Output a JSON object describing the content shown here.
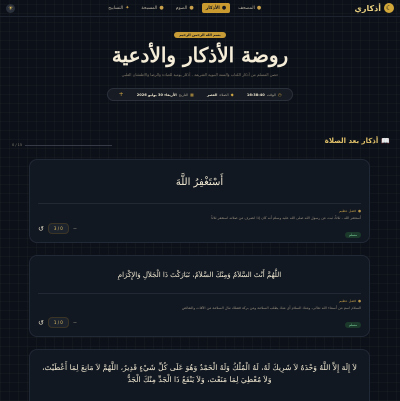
{
  "nav": {
    "brand": "أذكاري",
    "items": [
      {
        "label": "المصحف",
        "active": false
      },
      {
        "label": "الأذكار",
        "active": true
      },
      {
        "label": "الصوم",
        "active": false
      },
      {
        "label": "المسبحة",
        "active": false
      },
      {
        "label": "التسابيح",
        "active": false
      }
    ]
  },
  "hero": {
    "badge": "بسم الله الرحمن الرحيم",
    "title": "روضة الأذكار والأدعية",
    "subtitle": "حصن المسلم من أذكار الكتاب والسنة النبوية الشريفة - أذكار يومية للعبادة والرضا والاطمئنان القلبي"
  },
  "info": {
    "time_label": "الوقت",
    "time": "16:38:40",
    "prayer_label": "الصلاة",
    "prayer": "العصر",
    "date_label": "التاريخ",
    "date": "الأربعاء 30 يوليو 2026"
  },
  "progress": {
    "count": "0 / 15",
    "value": 0
  },
  "section": {
    "title": "أذكار بعد الصلاة"
  },
  "cards": [
    {
      "dhikr": "أَسْتَغْفِرُ اللَّهَ",
      "note_tag": "فضل عظيم",
      "note_text": "أستغفر الله - ثلاثاً، ثبت عن رسول الله صلى الله عليه وسلم أنه كان إذا انصرف من صلاته استغفر ثلاثاً",
      "source": "مسلم",
      "count": "3 / 0"
    },
    {
      "dhikr": "اللَّهُمَّ أَنْتَ السَّلاَمُ وَمِنْكَ السَّلاَمُ، تَبَارَكْتَ ذَا الْجَلاَلِ وَالإِكْرَامِ",
      "note_tag": "فضل عظيم",
      "note_text": "السلام اسم من أسماء الله تعالى، ومنك السلام أي منك يطلب السلامة ومن بركة فضلك ننال السلامة من الآفات والنقائص",
      "source": "مسلم",
      "count": "1 / 0"
    },
    {
      "dhikr": "لاَ إِلَهَ إِلاَّ اللَّهُ وَحْدَهُ لاَ شَرِيكَ لَهُ، لَهُ الْمُلْكُ وَلَهُ الْحَمْدُ وَهُوَ عَلَى كُلِّ شَيْءٍ قَدِيرٌ، اللَّهُمَّ لاَ مَانِعَ لِمَا أَعْطَيْتَ، وَلاَ مُعْطِيَ لِمَا مَنَعْتَ، وَلاَ يَنْفَعُ ذَا الْجَدِّ مِنْكَ الْجَدُّ"
    }
  ],
  "colors": {
    "accent": "#c99a30",
    "bg": "#0c1018",
    "card": "#121822"
  },
  "icons": {
    "brand": "crescent-moon-icon",
    "theme": "sun-icon",
    "section": "book-icon",
    "reset": "reset-icon"
  }
}
